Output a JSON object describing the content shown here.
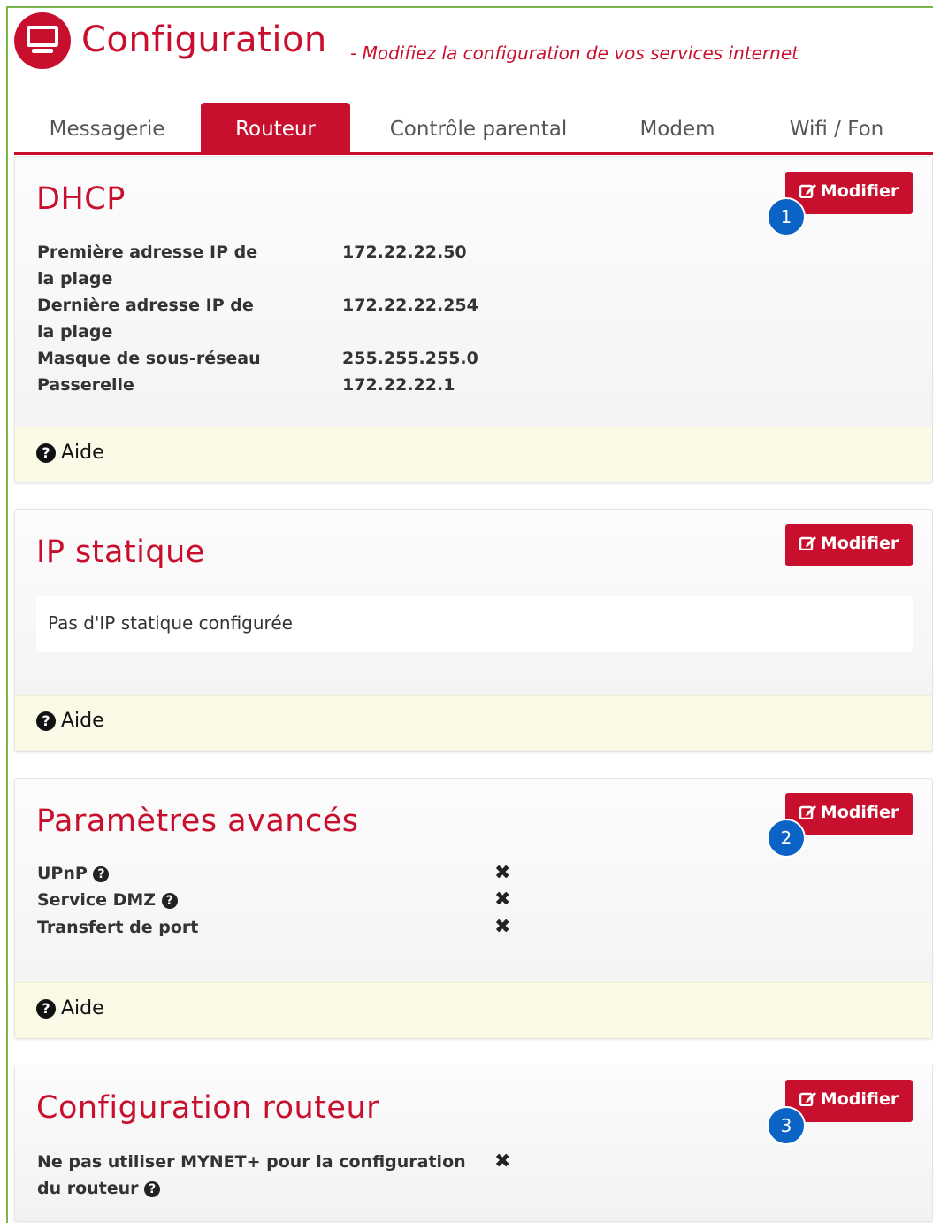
{
  "header": {
    "title": "Configuration",
    "subtitle": "- Modifiez la configuration de vos services internet",
    "icon": "monitor-icon",
    "accent_color": "#c8102e"
  },
  "tabs": [
    {
      "label": "Messagerie",
      "active": false
    },
    {
      "label": "Routeur",
      "active": true
    },
    {
      "label": "Contrôle parental",
      "active": false
    },
    {
      "label": "Modem",
      "active": false
    },
    {
      "label": "Wifi / Fon",
      "active": false
    }
  ],
  "edit_label": "Modifier",
  "help_label": "Aide",
  "help_icon": "question-circle-icon",
  "edit_icon": "edit-icon",
  "dhcp": {
    "title": "DHCP",
    "badge": "1",
    "rows": [
      {
        "label": "Première adresse IP de la plage",
        "value": "172.22.22.50"
      },
      {
        "label": "Dernière adresse IP de la plage",
        "value": "172.22.22.254"
      },
      {
        "label": "Masque de sous-réseau",
        "value": "255.255.255.0"
      },
      {
        "label": "Passerelle",
        "value": "172.22.22.1"
      }
    ]
  },
  "static_ip": {
    "title": "IP statique",
    "empty_text": "Pas d'IP statique configurée"
  },
  "advanced": {
    "title": "Paramètres avancés",
    "badge": "2",
    "rows": [
      {
        "label": "UPnP",
        "value": "✖",
        "has_help": true
      },
      {
        "label": "Service DMZ",
        "value": "✖",
        "has_help": true
      },
      {
        "label": "Transfert de port",
        "value": "✖",
        "has_help": false
      }
    ]
  },
  "router_config": {
    "title": "Configuration routeur",
    "badge": "3",
    "rows": [
      {
        "label": "Ne pas utiliser MYNET+ pour la configuration du routeur",
        "value": "✖",
        "has_help": true
      }
    ]
  }
}
